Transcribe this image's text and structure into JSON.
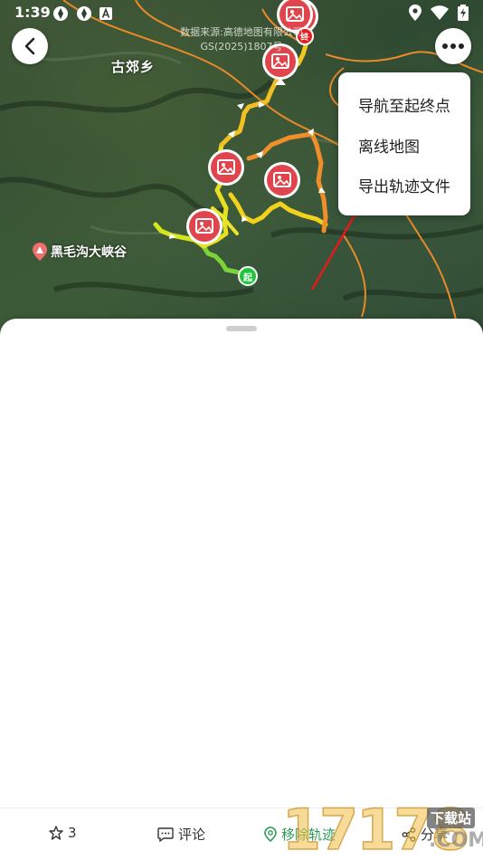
{
  "status_bar": {
    "time": "1:39",
    "left_icons": [
      "compass-icon",
      "compass-icon",
      "a-box-icon"
    ],
    "right_icons": [
      "location-icon",
      "wifi-icon",
      "battery-icon"
    ]
  },
  "map": {
    "source_line1": "数据来源:高德地图有限公司",
    "source_line2": "GS(2025)1807号",
    "place_name": "古郊乡",
    "poi_name": "黑毛沟大峡谷",
    "start_marker": "起",
    "end_marker": "终",
    "photo_marker_count": 6
  },
  "menu": {
    "items": [
      "导航至起终点",
      "离线地图",
      "导出轨迹文件"
    ]
  },
  "bottom_bar": {
    "favorite_count": "3",
    "comment_label": "评论",
    "remove_label": "移除轨迹",
    "share_label": "分享"
  },
  "watermark": {
    "digits": "17178",
    "site_label": "下载站",
    "domain": ".COM"
  },
  "colors": {
    "accent_green": "#2e9a55",
    "photo_marker_red": "#e0454d",
    "annotation_arrow": "#e21a1a"
  }
}
